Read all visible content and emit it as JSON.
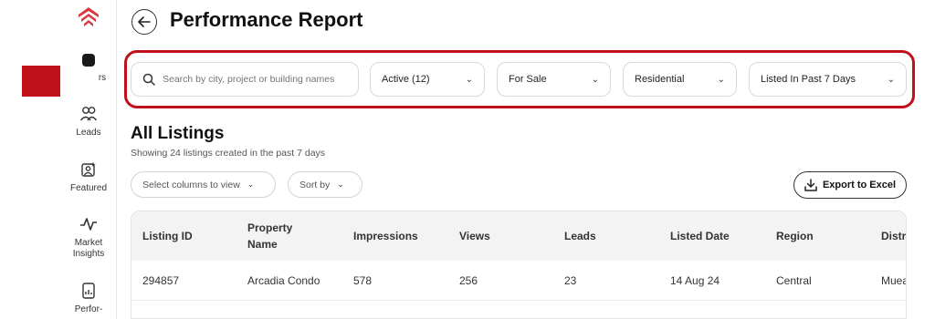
{
  "header": {
    "title": "Performance Report"
  },
  "sidebar": {
    "items": [
      {
        "label": "rs",
        "icon": "listings-icon"
      },
      {
        "label": "Leads",
        "icon": "users-icon"
      },
      {
        "label": "Featured",
        "icon": "featured-icon"
      },
      {
        "label": "Market\nInsights",
        "icon": "trend-icon"
      },
      {
        "label": "Perfor-",
        "icon": "report-icon"
      }
    ]
  },
  "filters": {
    "search_placeholder": "Search by city, project or building names",
    "status": "Active (12)",
    "listing_type": "For Sale",
    "property_type": "Residential",
    "date_range": "Listed In Past 7 Days"
  },
  "listings": {
    "title": "All Listings",
    "subtitle": "Showing 24 listings created in the past 7 days",
    "columns_button": "Select columns to view",
    "sort_button": "Sort by",
    "export_button": "Export to Excel"
  },
  "table": {
    "headers": [
      "Listing ID",
      "Property\nName",
      "Impressions",
      "Views",
      "Leads",
      "Listed Date",
      "Region",
      "Distr"
    ],
    "rows": [
      [
        "294857",
        "Arcadia Condo",
        "578",
        "256",
        "23",
        "14 Aug 24",
        "Central",
        "Muea"
      ]
    ]
  },
  "colors": {
    "accent": "#c0101a",
    "brand": "#d9363e"
  }
}
